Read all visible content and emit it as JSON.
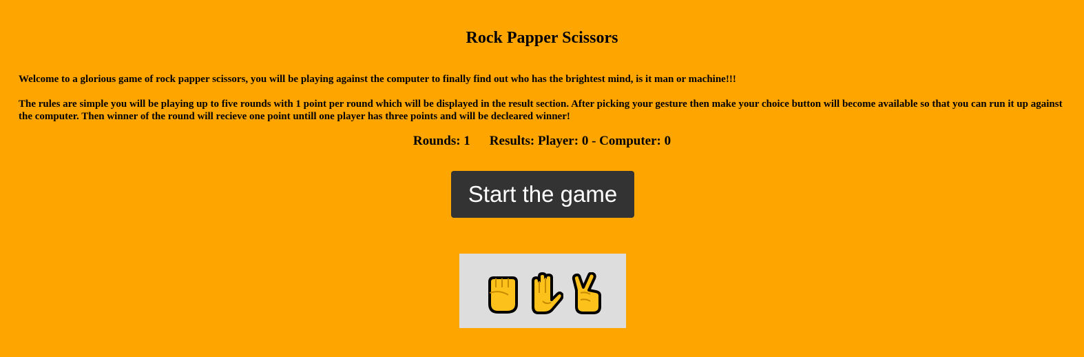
{
  "header": {
    "title": "Rock Papper Scissors"
  },
  "intro": {
    "welcome": "Welcome to a glorious game of rock papper scissors, you will be playing against the computer to finally find out who has the brightest mind, is it man or machine!!!",
    "rules": "The rules are simple you will be playing up to five rounds with 1 point per round which will be displayed in the result section. After picking your gesture then make your choice button will become available so that you can run it up against the computer. Then winner of the round will recieve one point untill one player has three points and will be decleared winner!"
  },
  "score": {
    "rounds_label": "Rounds: 1",
    "results_label": "Results: Player: 0 - Computer: 0"
  },
  "controls": {
    "start_label": "Start the game"
  },
  "gestures": [
    {
      "name": "rock",
      "icon": "raised-fist-icon"
    },
    {
      "name": "paper",
      "icon": "raised-hand-icon"
    },
    {
      "name": "scissors",
      "icon": "victory-hand-icon"
    }
  ],
  "colors": {
    "background": "#FFA500",
    "button_bg": "#333333",
    "button_text": "#FFFFFF",
    "panel_bg": "#DDDDDD",
    "emoji_fill": "#FCC21B"
  }
}
